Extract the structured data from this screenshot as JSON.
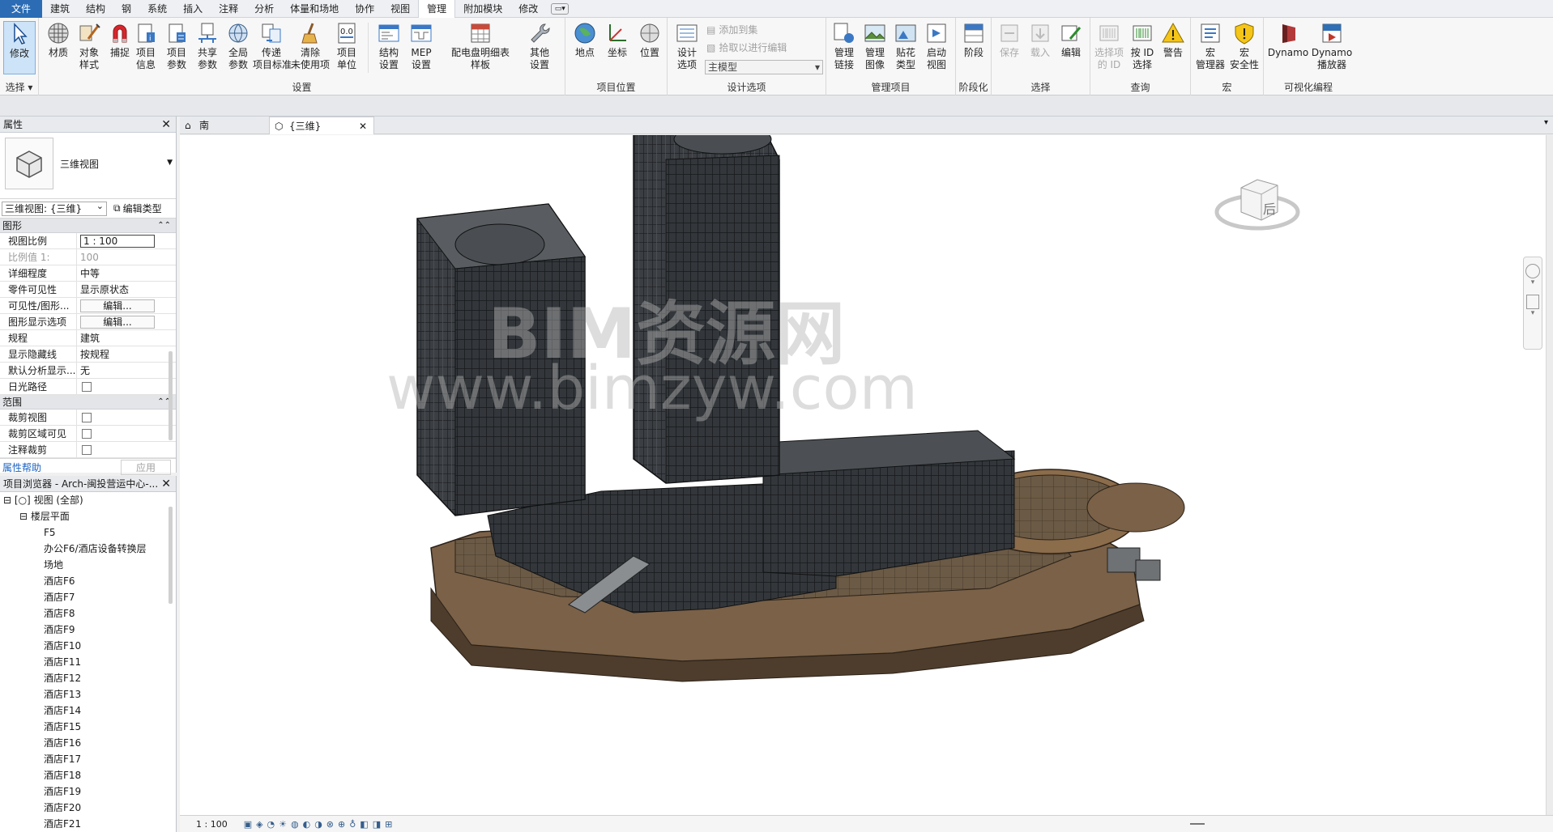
{
  "menubar": {
    "file": "文件",
    "tabs": [
      "建筑",
      "结构",
      "钢",
      "系统",
      "插入",
      "注释",
      "分析",
      "体量和场地",
      "协作",
      "视图",
      "管理",
      "附加模块",
      "修改"
    ],
    "active": "管理"
  },
  "ribbon": {
    "select": {
      "modify": "修改",
      "label": "选择 ▾"
    },
    "settings": {
      "buttons": [
        "材质",
        "对象\n样式",
        "捕捉",
        "项目\n信息",
        "项目\n参数",
        "共享\n参数",
        "全局\n参数",
        "传递\n项目标准",
        "清除\n未使用项",
        "项目\n单位",
        "结构\n设置",
        "MEP\n设置",
        "配电盘明细表\n样板",
        "其他\n设置"
      ],
      "label": "设置"
    },
    "location": {
      "buttons": [
        "地点",
        "坐标",
        "位置"
      ],
      "label": "项目位置"
    },
    "design_options": {
      "button": "设计\n选项",
      "add": "添加到集",
      "pick": "拾取以进行编辑",
      "combo": "主模型",
      "label": "设计选项"
    },
    "manage_project": {
      "buttons": [
        "管理\n链接",
        "管理\n图像",
        "贴花\n类型",
        "启动\n视图"
      ],
      "label": "管理项目"
    },
    "phasing": {
      "button": "阶段",
      "label": "阶段化"
    },
    "selection": {
      "buttons": [
        "保存",
        "载入",
        "编辑"
      ],
      "label": "选择"
    },
    "inquiry": {
      "buttons": [
        "选择项\n的 ID",
        "按 ID\n选择",
        "警告"
      ],
      "label": "查询"
    },
    "macros": {
      "buttons": [
        "宏\n管理器",
        "宏\n安全性"
      ],
      "label": "宏"
    },
    "visual_prog": {
      "buttons": [
        "Dynamo",
        "Dynamo\n播放器"
      ],
      "label": "可视化编程"
    }
  },
  "properties": {
    "title": "属性",
    "type_name": "三维视图",
    "instance": "三维视图: {三维}",
    "edit_type": "编辑类型",
    "cat_graphics": "图形",
    "rows": [
      {
        "name": "视图比例",
        "value": "1 : 100",
        "kind": "box"
      },
      {
        "name": "比例值 1:",
        "value": "100",
        "kind": "dim"
      },
      {
        "name": "详细程度",
        "value": "中等"
      },
      {
        "name": "零件可见性",
        "value": "显示原状态"
      },
      {
        "name": "可见性/图形...",
        "value": "编辑...",
        "kind": "btn"
      },
      {
        "name": "图形显示选项",
        "value": "编辑...",
        "kind": "btn"
      },
      {
        "name": "规程",
        "value": "建筑"
      },
      {
        "name": "显示隐藏线",
        "value": "按规程"
      },
      {
        "name": "默认分析显示...",
        "value": "无"
      },
      {
        "name": "日光路径",
        "value": "",
        "kind": "chk"
      }
    ],
    "cat_extents": "范围",
    "rows2": [
      {
        "name": "裁剪视图",
        "kind": "chk"
      },
      {
        "name": "裁剪区域可见",
        "kind": "chk"
      },
      {
        "name": "注释裁剪",
        "kind": "chk"
      }
    ],
    "help": "属性帮助",
    "apply": "应用"
  },
  "browser": {
    "title": "项目浏览器 - Arch-闽投营运中心-...",
    "root": "视图 (全部)",
    "floor_plans": "楼层平面",
    "items": [
      "F5",
      "办公F6/酒店设备转换层",
      "场地",
      "酒店F6",
      "酒店F7",
      "酒店F8",
      "酒店F9",
      "酒店F10",
      "酒店F11",
      "酒店F12",
      "酒店F13",
      "酒店F14",
      "酒店F15",
      "酒店F16",
      "酒店F17",
      "酒店F18",
      "酒店F19",
      "酒店F20",
      "酒店F21"
    ]
  },
  "doc_tabs": [
    {
      "label": "南"
    },
    {
      "label": "{三维}",
      "active": true
    }
  ],
  "viewcube": {
    "face": "后"
  },
  "watermark": {
    "line1": "BIM资源网",
    "line2": "www.bimzyw.com"
  },
  "status": {
    "scale": "1 : 100"
  }
}
